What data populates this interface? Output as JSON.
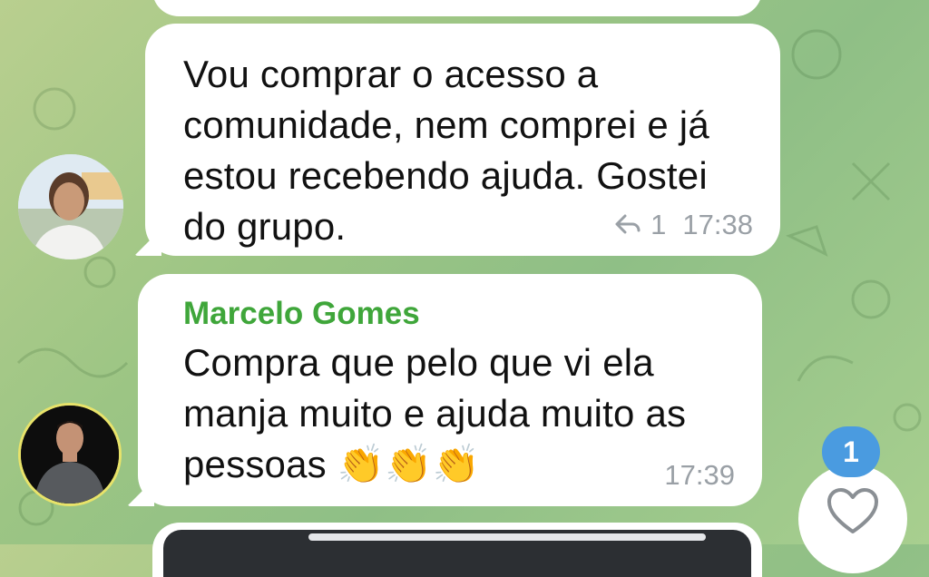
{
  "messages": [
    {
      "text": "Vou comprar o acesso a comunidade, nem comprei e já estou recebendo ajuda. Gostei do grupo.",
      "reply_count": "1",
      "time": "17:38"
    },
    {
      "sender": "Marcelo Gomes",
      "text": "Compra que pelo que vi ela manja muito e ajuda muito as pessoas",
      "emoji": "👏👏👏",
      "time": "17:39"
    }
  ],
  "reaction_badge": "1",
  "icons": [
    "reply-arrow-icon",
    "heart-icon"
  ],
  "colors": {
    "sender": "#3fa63a",
    "badge": "#4a9be0",
    "meta": "#9aa0a6"
  }
}
